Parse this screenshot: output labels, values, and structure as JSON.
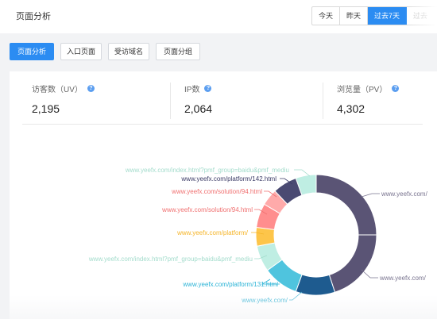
{
  "header": {
    "title": "页面分析",
    "ranges": [
      {
        "label": "今天",
        "active": false
      },
      {
        "label": "昨天",
        "active": false
      },
      {
        "label": "过去7天",
        "active": true
      },
      {
        "label": "过去",
        "active": false
      }
    ]
  },
  "tabs": [
    {
      "label": "页面分析",
      "active": true
    },
    {
      "label": "入口页面",
      "active": false
    },
    {
      "label": "受访域名",
      "active": false
    },
    {
      "label": "页面分组",
      "active": false
    }
  ],
  "stats": [
    {
      "label": "访客数（UV）",
      "value": "2,195",
      "icon": "help-icon"
    },
    {
      "label": "IP数",
      "value": "2,064",
      "icon": "help-icon"
    },
    {
      "label": "浏览量（PV）",
      "value": "4,302",
      "icon": "help-icon"
    }
  ],
  "colors": {
    "accent": "#2b8cf2",
    "page_bg": "#f2f3f5"
  },
  "chart_data": {
    "type": "pie",
    "donut": true,
    "slices": [
      {
        "label": "www.yeefx.com/",
        "value": 0.25,
        "color": "#5a5475",
        "label_color": "#7a7590"
      },
      {
        "label": "www.yeefx.com/",
        "value": 0.2,
        "color": "#5a5475",
        "label_color": "#7a7590"
      },
      {
        "label": "www.yeefx.com/",
        "value": 0.105,
        "color": "#1e5b8f",
        "label_color": "#5ac0dc"
      },
      {
        "label": "www.yeefx.com/platform/131.html",
        "value": 0.095,
        "color": "#4fc4de",
        "label_color": "#2ab3d6"
      },
      {
        "label": "www.yeefx.com/index.html?pmf_group=baidu&pmf_mediu",
        "value": 0.07,
        "color": "#bfeee3",
        "label_color": "#a3dccc"
      },
      {
        "label": "www.yeefx.com/platform/",
        "value": 0.05,
        "color": "#fdc54a",
        "label_color": "#f5b52a"
      },
      {
        "label": "www.yeefx.com/solution/94.html",
        "value": 0.065,
        "color": "#ff8e8e",
        "label_color": "#f07070"
      },
      {
        "label": "www.yeefx.com/solution/94.html",
        "value": 0.045,
        "color": "#ffaaaa",
        "label_color": "#f07070"
      },
      {
        "label": "www.yeefx.com/platform/142.html",
        "value": 0.065,
        "color": "#4a4a72",
        "label_color": "#3b3b66"
      },
      {
        "label": "www.yeefx.com/index.html?pmf_group=baidu&pmf_mediu",
        "value": 0.055,
        "color": "#bfeee3",
        "label_color": "#a3dccc"
      }
    ]
  }
}
